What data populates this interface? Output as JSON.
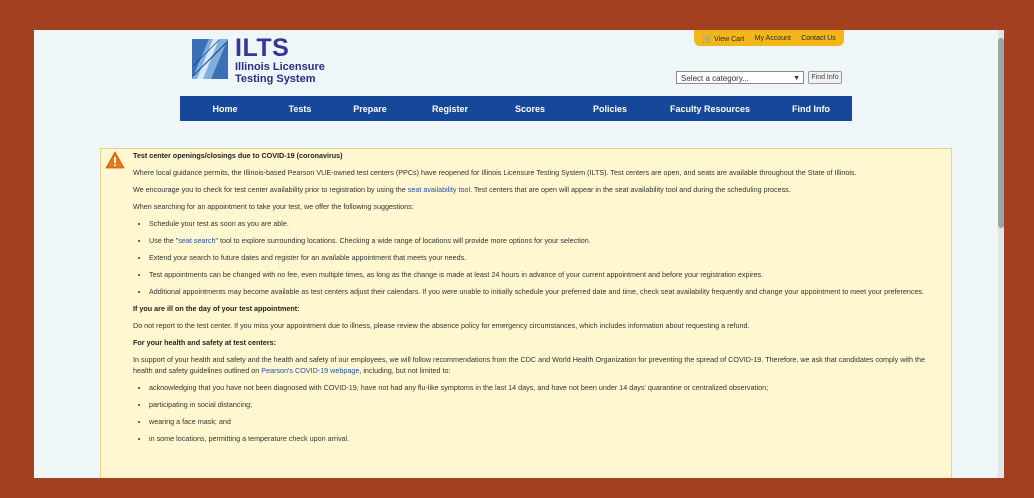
{
  "header": {
    "logo_title": "ILTS",
    "logo_subtitle_line1": "Illinois Licensure",
    "logo_subtitle_line2": "Testing System",
    "util_links": {
      "cart": "View Cart",
      "account": "My Account",
      "contact": "Contact Us"
    },
    "category_select": {
      "value": "Select a category..."
    },
    "find_button": "Find Info"
  },
  "nav": {
    "items": [
      "Home",
      "Tests",
      "Prepare",
      "Register",
      "Scores",
      "Policies",
      "Faculty Resources",
      "Find Info"
    ]
  },
  "alert": {
    "title": "Test center openings/closings due to COVID-19 (coronavirus)",
    "p1": "Where local guidance permits, the Illinois-based Pearson VUE-owned test centers (PPCs) have reopened for Illinois Licensure Testing System (ILTS). Test centers are open, and seats are available throughout the State of Illinois.",
    "p2_before": "We encourage you to check for test center availability prior to registration by using the ",
    "p2_link": "seat availability tool",
    "p2_after": ". Test centers that are open will appear in the seat availability tool and during the scheduling process.",
    "p3": "When searching for an appointment to take your test, we offer the following suggestions:",
    "suggestions": {
      "s1": "Schedule your test as soon as you are able.",
      "s2_before": "Use the \"",
      "s2_link": "seat search",
      "s2_after": "\" tool to explore surrounding locations. Checking a wide range of locations will provide more options for your selection.",
      "s3": "Extend your search to future dates and register for an available appointment that meets your needs.",
      "s4": "Test appointments can be changed with no fee, even multiple times, as long as the change is made at least 24 hours in advance of your current appointment and before your registration expires.",
      "s5": "Additional appointments may become available as test centers adjust their calendars. If you were unable to initially schedule your preferred date and time, check seat availability frequently and change your appointment to meet your preferences."
    },
    "ill_heading": "If you are ill on the day of your test appointment:",
    "ill_text": "Do not report to the test center. If you miss your appointment due to illness, please review the absence policy for emergency circumstances, which includes information about requesting a refund.",
    "health_heading": "For your health and safety at test centers:",
    "health_before": "In support of your health and safety and the health and safety of our employees, we will follow recommendations from the CDC and World Health Organization for preventing the spread of COVID-19. Therefore, we ask that candidates comply with the health and safety guidelines outlined on ",
    "health_link": "Pearson's COVID-19 webpage",
    "health_after": ", including, but not limited to:",
    "guidelines": {
      "g1": "acknowledging that you have not been diagnosed with COVID-19, have not had any flu-like symptoms in the last 14 days, and have not been under 14 days' quarantine or centralized observation;",
      "g2": "participating in social distancing;",
      "g3": "wearing a face mask; and",
      "g4": "in some locations, permitting a temperature check upon arrival."
    }
  },
  "colors": {
    "frame": "#a3401f",
    "nav": "#17479a",
    "util_bar": "#f2b51a",
    "alert_bg": "#fff7cf",
    "link": "#1f4fb3"
  }
}
